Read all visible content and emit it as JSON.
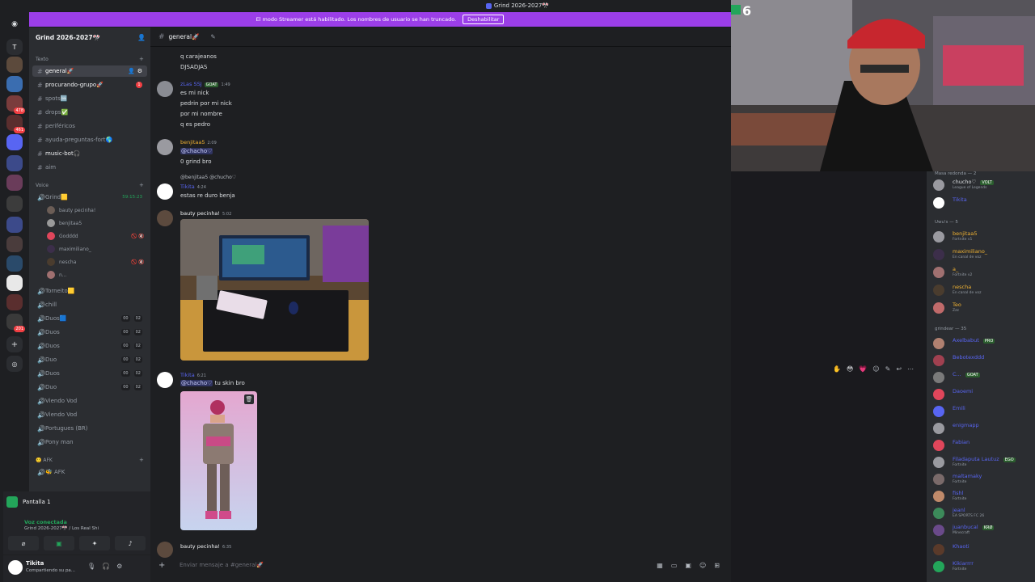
{
  "window": {
    "title": "Grind 2026-2027🎌"
  },
  "banner": {
    "text": "El modo Streamer está habilitado. Los nombres de usuario se han truncado.",
    "button": "Deshabilitar"
  },
  "rail": {
    "badges": [
      "478",
      "461",
      "201"
    ]
  },
  "server": {
    "name": "Grind 2026-2027🎌"
  },
  "categories": {
    "text": "Texto",
    "voice": "Voice",
    "afk": "🙂 AFK"
  },
  "text_channels": [
    {
      "name": "general🚀",
      "active": true
    },
    {
      "name": "procurando-grupo🚀",
      "unread": "1"
    },
    {
      "name": "spots🆒"
    },
    {
      "name": "drops✅"
    },
    {
      "name": "periféricos"
    },
    {
      "name": "ayuda-preguntas-fort🌎"
    },
    {
      "name": "music-bot🎧"
    },
    {
      "name": "aim"
    }
  ],
  "voice_channels": [
    {
      "name": "Grind🟨",
      "timer": "59:15:23"
    },
    {
      "name": "Torneito🟨"
    },
    {
      "name": "chill"
    },
    {
      "name": "Duos🟦",
      "count": "00",
      "limit": "02"
    },
    {
      "name": "Duos",
      "count": "00",
      "limit": "02"
    },
    {
      "name": "Duos",
      "count": "00",
      "limit": "02"
    },
    {
      "name": "Duo",
      "count": "00",
      "limit": "02"
    },
    {
      "name": "Duos",
      "count": "00",
      "limit": "02"
    },
    {
      "name": "Duo",
      "count": "00",
      "limit": "02"
    },
    {
      "name": "Viendo Vod"
    },
    {
      "name": "Viendo Vod"
    },
    {
      "name": "Portugues (BR)"
    },
    {
      "name": "Pony man"
    }
  ],
  "voice_users": [
    {
      "name": "bauty pecinha!"
    },
    {
      "name": "benjitaa5"
    },
    {
      "name": "Godddd",
      "icons": "🚫 🔇"
    },
    {
      "name": "maximiliano_"
    },
    {
      "name": "nescha",
      "icons": "🚫 🔇"
    },
    {
      "name": "n..."
    }
  ],
  "afk_channel": {
    "name": "🐝 AFK"
  },
  "voice_panel": {
    "screen": "Pantalla 1",
    "connected": "Voz conectada",
    "sub": "Grind 2026-2027🎌 / Los Real Shi"
  },
  "user": {
    "name": "Tikita",
    "status": "Compartiendo su pa..."
  },
  "chat": {
    "channel": "general🚀",
    "messages": [
      {
        "lines": [
          "q carajeanos",
          "DJSADJAS"
        ]
      },
      {
        "author": "zLas SSJ",
        "tag": "GOAT",
        "time": "1:49",
        "lines": [
          "es mi nick",
          "pedrin por mi nick",
          "por mi nombre",
          "q es pedro"
        ]
      },
      {
        "author": "benjitaa5",
        "time": "2:09",
        "mention": "@chacho♡",
        "lines": [
          "0 grind bro"
        ]
      },
      {
        "reply": "@benjitaa5 @chucho♡",
        "author": "Tikita",
        "time": "4:24",
        "lines": [
          "estas re duro benja"
        ]
      },
      {
        "author": "bauty pecinha!",
        "time": "5:02"
      },
      {
        "author": "Tikita",
        "time": "6:21",
        "mention": "@chacho♡",
        "after": "tu skin bro"
      },
      {
        "author": "bauty pecinha!",
        "time": "6:35"
      }
    ],
    "placeholder": "Enviar mensaje a #general🚀"
  },
  "webcam": {
    "overlay": "6"
  },
  "members": {
    "groups": [
      {
        "title": "Masa redonda — 2",
        "people": [
          {
            "name": "chucho♡",
            "tag": "VOLT",
            "status": "League of Legends"
          },
          {
            "name": "Tikita"
          }
        ]
      },
      {
        "title": "Uwu's — 5",
        "people": [
          {
            "name": "benjitaa5",
            "status": "Fortnite v1"
          },
          {
            "name": "maximiliano_",
            "status": "En canal de voz"
          },
          {
            "name": "a_",
            "status": "Fortnite v2"
          },
          {
            "name": "nescha",
            "status": "En canal de voz"
          },
          {
            "name": "Teo",
            "status": "Zzz"
          }
        ]
      },
      {
        "title": "grindear — 35",
        "people": [
          {
            "name": "Axelbabut",
            "tag": "PRO"
          },
          {
            "name": "Bebotexddd"
          },
          {
            "name": "C...",
            "tag": "GOAT"
          },
          {
            "name": "Daoemi"
          },
          {
            "name": "Emili"
          },
          {
            "name": "enigmapp"
          },
          {
            "name": "Fabian"
          },
          {
            "name": "Filadaputa Lautuz",
            "tag": "EGO",
            "status": "Fortnite"
          },
          {
            "name": "maltamaky",
            "status": "Fortnite"
          },
          {
            "name": "fishl",
            "status": "Fortnite"
          },
          {
            "name": "jeanl",
            "status": "EA SPORTS FC 26"
          },
          {
            "name": "juanbucal",
            "tag": "KRØ",
            "status": "Minecraft"
          },
          {
            "name": "Khaoti"
          },
          {
            "name": "Kikiarrrr",
            "status": "Fortnite"
          }
        ]
      }
    ]
  },
  "colors": {
    "accent": "#5865f2",
    "streamer": "#9b3ee8",
    "online": "#23a55a",
    "brand_mention": "#c9cdfb"
  }
}
